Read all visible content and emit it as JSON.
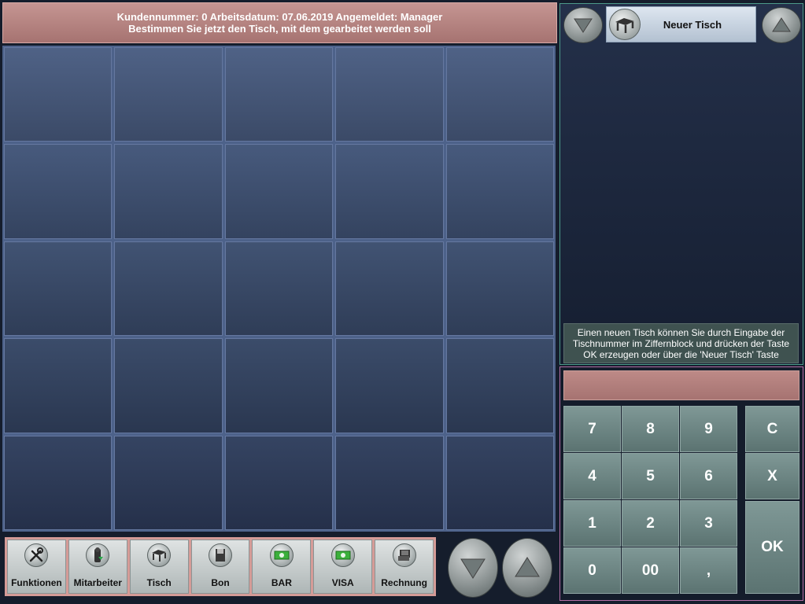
{
  "header": {
    "line1": "Kundennummer: 0 Arbeitsdatum: 07.06.2019 Angemeldet: Manager",
    "line2": "Bestimmen Sie jetzt den Tisch, mit dem gearbeitet werden soll"
  },
  "toolbar": {
    "items": [
      {
        "label": "Funktionen",
        "icon": "tools-icon"
      },
      {
        "label": "Mitarbeiter",
        "icon": "employee-icon"
      },
      {
        "label": "Tisch",
        "icon": "table-icon"
      },
      {
        "label": "Bon",
        "icon": "receipt-icon"
      },
      {
        "label": "BAR",
        "icon": "cash-icon"
      },
      {
        "label": "VISA",
        "icon": "card-icon"
      },
      {
        "label": "Rechnung",
        "icon": "invoice-icon"
      }
    ]
  },
  "right_panel": {
    "new_table_label": "Neuer Tisch",
    "info_text": "Einen neuen Tisch können Sie durch Eingabe der Tischnummer im Ziffernblock und drücken der Taste OK erzeugen oder über die 'Neuer Tisch' Taste",
    "display_value": ""
  },
  "keypad": {
    "k7": "7",
    "k8": "8",
    "k9": "9",
    "k4": "4",
    "k5": "5",
    "k6": "6",
    "k1": "1",
    "k2": "2",
    "k3": "3",
    "k0": "0",
    "k00": "00",
    "kcomma": ",",
    "clear": "C",
    "cancel": "X",
    "ok": "OK"
  },
  "colors": {
    "header_bg": "#b07e7c",
    "panel_border": "#4d9a8a",
    "keypad_border": "#b46ea6",
    "key_bg": "#6d8583"
  }
}
